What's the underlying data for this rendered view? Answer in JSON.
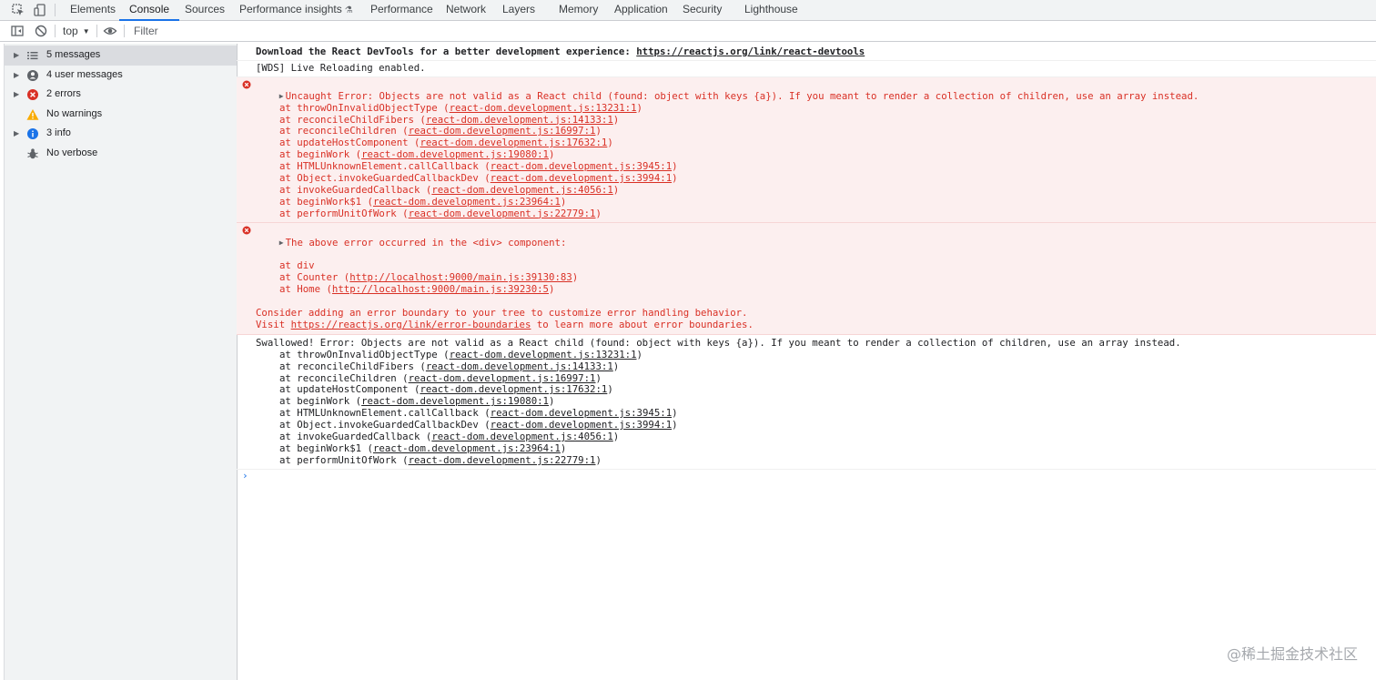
{
  "tabs": [
    "Elements",
    "Console",
    "Sources",
    "Performance insights",
    "Performance",
    "Network",
    "Layers",
    "Memory",
    "Application",
    "Security",
    "Lighthouse"
  ],
  "active_tab": "Console",
  "toolbar": {
    "context": "top",
    "filter_placeholder": "Filter"
  },
  "sidebar": {
    "items": [
      {
        "label": "5 messages",
        "icon": "list-icon"
      },
      {
        "label": "4 user messages",
        "icon": "user-icon"
      },
      {
        "label": "2 errors",
        "icon": "error-icon"
      },
      {
        "label": "No warnings",
        "icon": "warning-icon"
      },
      {
        "label": "3 info",
        "icon": "info-icon"
      },
      {
        "label": "No verbose",
        "icon": "bug-icon"
      }
    ]
  },
  "console": {
    "msg1": {
      "text": "Download the React DevTools for a better development experience: ",
      "link": "https://reactjs.org/link/react-devtools"
    },
    "msg2": "[WDS] Live Reloading enabled.",
    "error1": {
      "head": "Uncaught Error: Objects are not valid as a React child (found: object with keys {a}). If you meant to render a collection of children, use an array instead.",
      "stack": [
        {
          "fn": "at throwOnInvalidObjectType",
          "src": "react-dom.development.js:13231:1"
        },
        {
          "fn": "at reconcileChildFibers",
          "src": "react-dom.development.js:14133:1"
        },
        {
          "fn": "at reconcileChildren",
          "src": "react-dom.development.js:16997:1"
        },
        {
          "fn": "at updateHostComponent",
          "src": "react-dom.development.js:17632:1"
        },
        {
          "fn": "at beginWork",
          "src": "react-dom.development.js:19080:1"
        },
        {
          "fn": "at HTMLUnknownElement.callCallback",
          "src": "react-dom.development.js:3945:1"
        },
        {
          "fn": "at Object.invokeGuardedCallbackDev",
          "src": "react-dom.development.js:3994:1"
        },
        {
          "fn": "at invokeGuardedCallback",
          "src": "react-dom.development.js:4056:1"
        },
        {
          "fn": "at beginWork$1",
          "src": "react-dom.development.js:23964:1"
        },
        {
          "fn": "at performUnitOfWork",
          "src": "react-dom.development.js:22779:1"
        }
      ]
    },
    "error2": {
      "head": "The above error occurred in the <div> component:",
      "stack": [
        {
          "fn": "at div",
          "src": ""
        },
        {
          "fn": "at Counter",
          "src": "http://localhost:9000/main.js:39130:83"
        },
        {
          "fn": "at Home",
          "src": "http://localhost:9000/main.js:39230:5"
        }
      ],
      "tail1": "Consider adding an error boundary to your tree to customize error handling behavior.",
      "tail2_pre": "Visit ",
      "tail2_link": "https://reactjs.org/link/error-boundaries",
      "tail2_post": " to learn more about error boundaries."
    },
    "msg3": {
      "head": "Swallowed! Error: Objects are not valid as a React child (found: object with keys {a}). If you meant to render a collection of children, use an array instead.",
      "stack": [
        {
          "fn": "at throwOnInvalidObjectType",
          "src": "react-dom.development.js:13231:1"
        },
        {
          "fn": "at reconcileChildFibers",
          "src": "react-dom.development.js:14133:1"
        },
        {
          "fn": "at reconcileChildren",
          "src": "react-dom.development.js:16997:1"
        },
        {
          "fn": "at updateHostComponent",
          "src": "react-dom.development.js:17632:1"
        },
        {
          "fn": "at beginWork",
          "src": "react-dom.development.js:19080:1"
        },
        {
          "fn": "at HTMLUnknownElement.callCallback",
          "src": "react-dom.development.js:3945:1"
        },
        {
          "fn": "at Object.invokeGuardedCallbackDev",
          "src": "react-dom.development.js:3994:1"
        },
        {
          "fn": "at invokeGuardedCallback",
          "src": "react-dom.development.js:4056:1"
        },
        {
          "fn": "at beginWork$1",
          "src": "react-dom.development.js:23964:1"
        },
        {
          "fn": "at performUnitOfWork",
          "src": "react-dom.development.js:22779:1"
        }
      ]
    },
    "prompt": "›"
  },
  "watermark": "@稀土掘金技术社区",
  "colors": {
    "error": "#d93025",
    "accent": "#1a73e8",
    "warning": "#f9ab00",
    "info": "#1a73e8"
  }
}
